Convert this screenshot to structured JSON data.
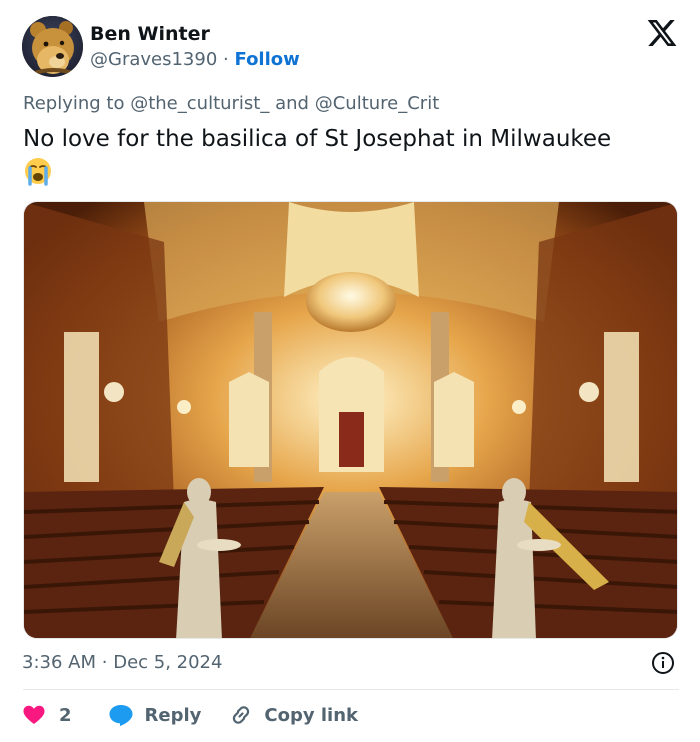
{
  "tweet": {
    "author": {
      "display_name": "Ben Winter",
      "handle": "@Graves1390",
      "separator": "·",
      "follow_label": "Follow"
    },
    "replying_to": {
      "prefix": "Replying to",
      "mention_1": "@the_culturist_",
      "conjunction": "and",
      "mention_2": "@Culture_Crit"
    },
    "text": "No love for the basilica of St Josephat in Milwaukee",
    "emoji": "loudly-crying-face",
    "image": {
      "subject": "basilica interior with angel statues"
    },
    "time": "3:36 AM",
    "date_separator": "·",
    "date": "Dec 5, 2024",
    "actions": {
      "like_count": "2",
      "reply_label": "Reply",
      "copy_label": "Copy link"
    }
  },
  "icons": {
    "logo": "x-logo-icon",
    "info": "info-icon",
    "like": "heart-icon",
    "reply": "reply-bubble-icon",
    "copy": "link-icon"
  },
  "colors": {
    "text": "#0f1419",
    "secondary": "#536471",
    "accent": "#0f73d4",
    "like": "#f91880",
    "reply": "#1d9bf0"
  }
}
